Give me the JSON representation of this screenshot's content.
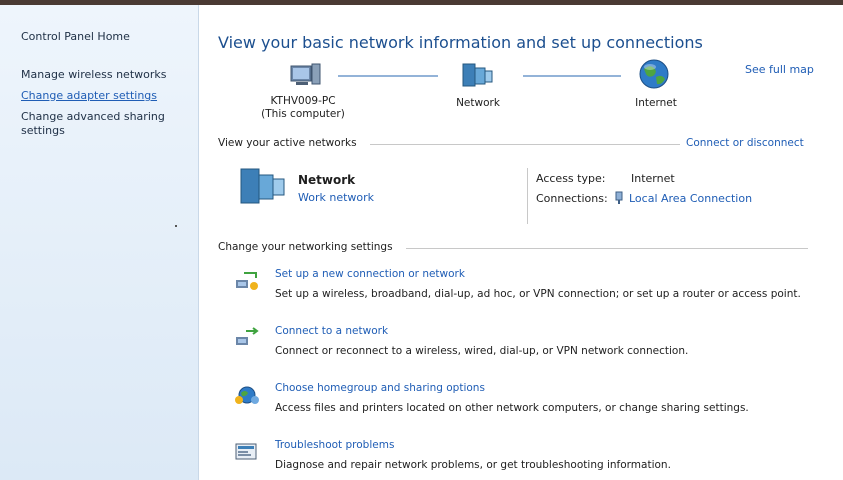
{
  "sidebar": {
    "home": "Control Panel Home",
    "items": [
      {
        "label": "Manage wireless networks"
      },
      {
        "label": "Change adapter settings"
      },
      {
        "label": "Change advanced sharing settings"
      }
    ]
  },
  "main": {
    "title": "View your basic network information and set up connections",
    "see_full_map": "See full map",
    "map": {
      "computer_name": "KTHV009-PC",
      "computer_sub": "(This computer)",
      "network": "Network",
      "internet": "Internet"
    },
    "active_networks": {
      "heading": "View your active networks",
      "connect_link": "Connect or disconnect",
      "network_name": "Network",
      "network_type": "Work network",
      "access_type_label": "Access type:",
      "access_type_value": "Internet",
      "connections_label": "Connections:",
      "connections_value": "Local Area Connection"
    },
    "settings": {
      "heading": "Change your networking settings",
      "tasks": [
        {
          "title": "Set up a new connection or network",
          "desc": "Set up a wireless, broadband, dial-up, ad hoc, or VPN connection; or set up a router or access point.",
          "icon": "new-connection-icon"
        },
        {
          "title": "Connect to a network",
          "desc": "Connect or reconnect to a wireless, wired, dial-up, or VPN network connection.",
          "icon": "connect-network-icon"
        },
        {
          "title": "Choose homegroup and sharing options",
          "desc": "Access files and printers located on other network computers, or change sharing settings.",
          "icon": "homegroup-icon"
        },
        {
          "title": "Troubleshoot problems",
          "desc": "Diagnose and repair network problems, or get troubleshooting information.",
          "icon": "troubleshoot-icon"
        }
      ]
    }
  },
  "colors": {
    "link": "#1f5db5",
    "title": "#1c4f8f",
    "sidebar_bg": "#e6f0fa"
  }
}
